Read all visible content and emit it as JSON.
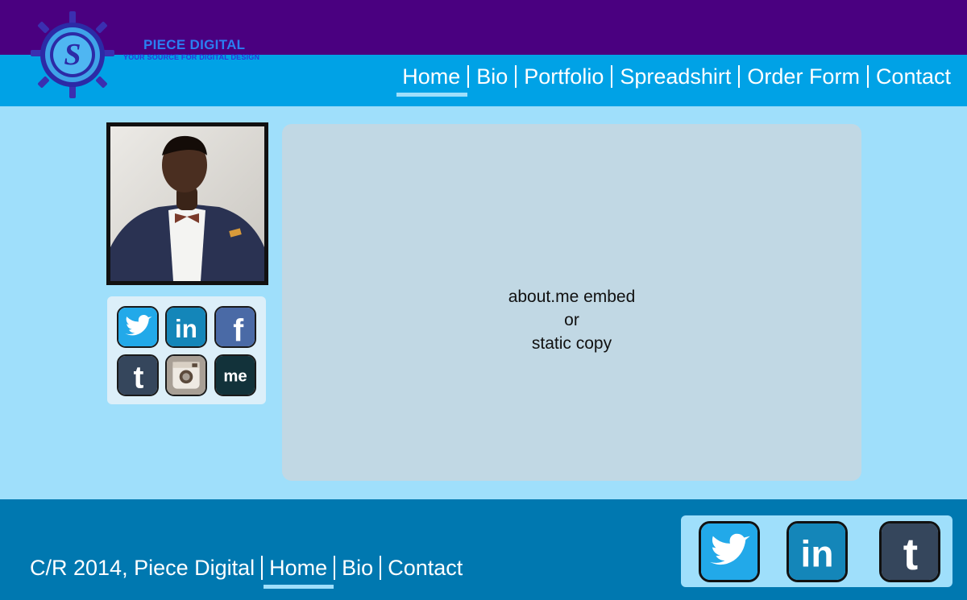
{
  "header": {
    "brand_name": "PIECE DIGITAL",
    "brand_tagline": "YOUR SOURCE FOR DIGITAL DESIGN",
    "logo_letter": "S"
  },
  "nav": {
    "items": [
      {
        "label": "Home",
        "active": true
      },
      {
        "label": "Bio"
      },
      {
        "label": "Portfolio"
      },
      {
        "label": "Spreadshirt"
      },
      {
        "label": "Order Form"
      },
      {
        "label": "Contact"
      }
    ]
  },
  "sidebar": {
    "social_icons": [
      {
        "name": "twitter-icon",
        "color": "#22a9e9"
      },
      {
        "name": "linkedin-icon",
        "color": "#1486b9",
        "glyph": "in"
      },
      {
        "name": "facebook-icon",
        "color": "#4a6aa6",
        "glyph": "f"
      },
      {
        "name": "tumblr-icon",
        "color": "#35465c",
        "glyph": "t"
      },
      {
        "name": "instagram-icon",
        "color": "#a89f95"
      },
      {
        "name": "aboutme-icon",
        "color": "#12323a",
        "glyph": "me"
      }
    ]
  },
  "main": {
    "placeholder_lines": [
      "about.me embed",
      "or",
      "static copy"
    ]
  },
  "footer": {
    "copyright": "C/R 2014, Piece Digital",
    "links": [
      {
        "label": "Home",
        "active": true
      },
      {
        "label": "Bio"
      },
      {
        "label": "Contact"
      }
    ],
    "social_icons": [
      {
        "name": "twitter-icon",
        "color": "#22a9e9"
      },
      {
        "name": "linkedin-icon",
        "color": "#1486b9",
        "glyph": "in"
      },
      {
        "name": "tumblr-icon",
        "color": "#35465c",
        "glyph": "t"
      }
    ]
  },
  "colors": {
    "top_bar": "#4a0080",
    "nav_bar": "#00a2e6",
    "page_background": "#9fdffb",
    "content_panel": "#c1d8e4",
    "footer": "#0078b0"
  }
}
